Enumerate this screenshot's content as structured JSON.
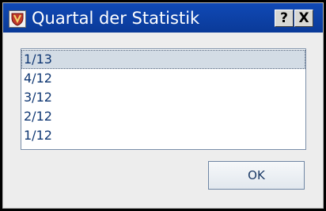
{
  "window": {
    "title": "Quartal der Statistik",
    "help_label": "?",
    "close_label": "X"
  },
  "list": {
    "items": [
      {
        "label": "1/13",
        "selected": true
      },
      {
        "label": "4/12",
        "selected": false
      },
      {
        "label": "3/12",
        "selected": false
      },
      {
        "label": "2/12",
        "selected": false
      },
      {
        "label": "1/12",
        "selected": false
      }
    ]
  },
  "buttons": {
    "ok_label": "OK"
  },
  "icons": {
    "app": "shield-icon"
  },
  "colors": {
    "titlebar": "#1049b6",
    "list_text": "#0f3773",
    "selection": "#d3dce5"
  }
}
